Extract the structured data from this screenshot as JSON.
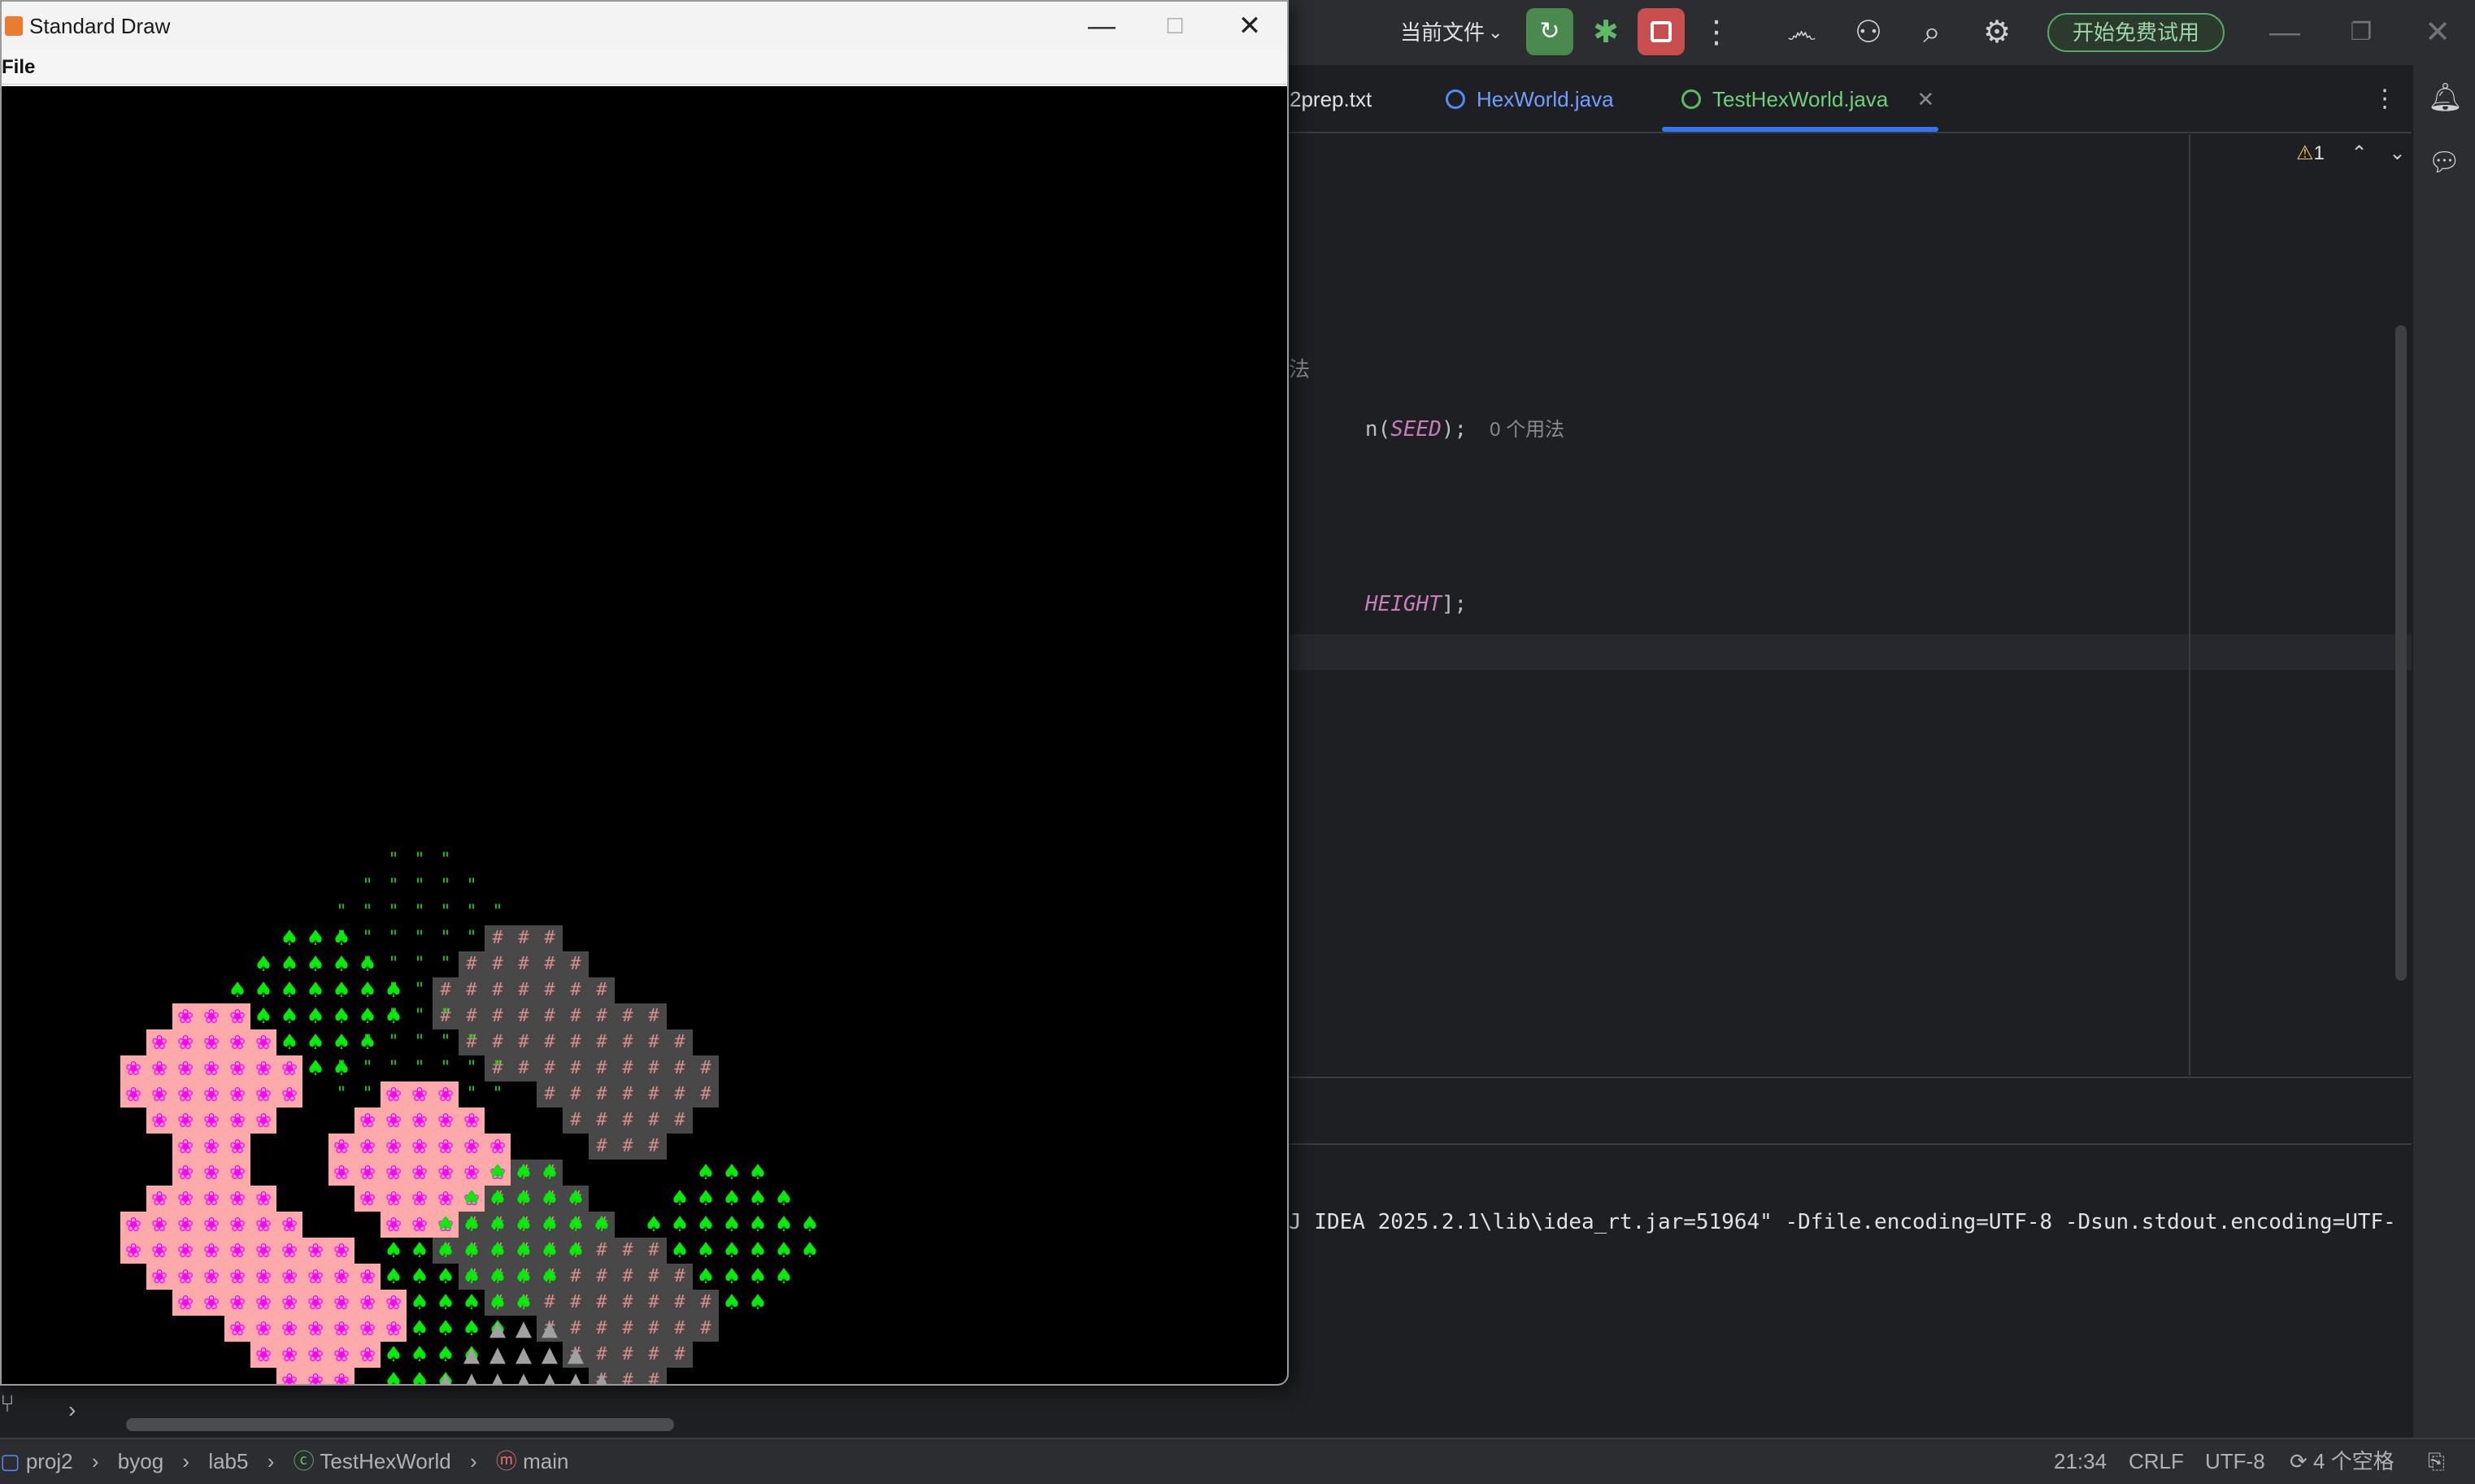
{
  "ide": {
    "toolbar": {
      "run_config": "当前文件",
      "trial_button": "开始免费试用",
      "icons": [
        "rerun-icon",
        "debug-icon",
        "stop-icon",
        "more-icon",
        "ai-assistant-icon",
        "add-user-icon",
        "search-icon",
        "settings-icon"
      ]
    },
    "tabs": [
      {
        "label": "2prep.txt"
      },
      {
        "label": "HexWorld.java"
      },
      {
        "label": "TestHexWorld.java",
        "active": true
      }
    ],
    "inspection": {
      "warnings": "1"
    },
    "code_lines": [
      {
        "text": "法"
      },
      {
        "text": "n(",
        "italic": "SEED",
        "rest": ");",
        "hint": "0 个用法"
      },
      {
        "italic": "HEIGHT",
        "rest": "];"
      }
    ],
    "console_text": "J IDEA 2025.2.1\\lib\\idea_rt.jar=51964\" -Dfile.encoding=UTF-8 -Dsun.stdout.encoding=UTF-",
    "statusbar": {
      "breadcrumbs": [
        "proj2",
        "byog",
        "lab5",
        "TestHexWorld",
        "main"
      ],
      "position": "21:34",
      "line_sep": "CRLF",
      "encoding": "UTF-8",
      "indent": "4 个空格"
    }
  },
  "std_draw": {
    "title": "Standard Draw",
    "menu": {
      "file": "File"
    },
    "window_controls": [
      "minimize-icon",
      "maximize-icon",
      "close-icon"
    ],
    "tile_glyphs": {
      "flower": "❀",
      "tree": "♠",
      "grass": "\"",
      "wall": "#",
      "mountain": "▲"
    },
    "colors": {
      "flower_bg": "#ffaaaa",
      "flower_fg": "#ff00ff",
      "tree": "#00ee00",
      "grass": "#00cc00",
      "wall_bg": "#484848",
      "wall_fg": "#d98b8b",
      "mountain": "#a0a0a0"
    }
  }
}
